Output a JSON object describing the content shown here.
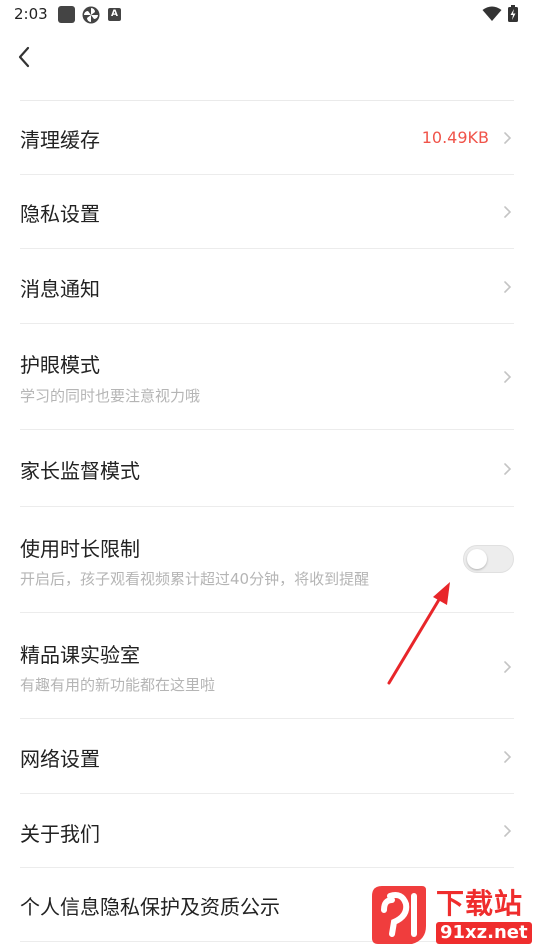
{
  "status_bar": {
    "time": "2:03",
    "icons": [
      "square-icon",
      "pinwheel-icon",
      "a-icon",
      "wifi-icon",
      "battery-charging-icon"
    ],
    "a_icon_glyph": "A"
  },
  "header": {
    "back_icon": "chevron-left-icon"
  },
  "settings": {
    "clear_cache": {
      "title": "清理缓存",
      "value": "10.49KB"
    },
    "privacy": {
      "title": "隐私设置"
    },
    "notifications": {
      "title": "消息通知"
    },
    "eye_care": {
      "title": "护眼模式",
      "subtitle": "学习的同时也要注意视力哦"
    },
    "parental": {
      "title": "家长监督模式"
    },
    "time_limit": {
      "title": "使用时长限制",
      "subtitle": "开启后，孩子观看视频累计超过40分钟，将收到提醒",
      "toggle_on": false
    },
    "lab": {
      "title": "精品课实验室",
      "subtitle": "有趣有用的新功能都在这里啦"
    },
    "network": {
      "title": "网络设置"
    },
    "about": {
      "title": "关于我们"
    },
    "personal_info": {
      "title": "个人信息隐私保护及资质公示"
    }
  },
  "watermark": {
    "logo_text": "下载站",
    "url": "91xz.net"
  },
  "colors": {
    "accent_red": "#f0544a",
    "subtitle_gray": "#b5b5b5",
    "chevron_gray": "#c4c4c4",
    "annotation_red": "#e8262a"
  }
}
